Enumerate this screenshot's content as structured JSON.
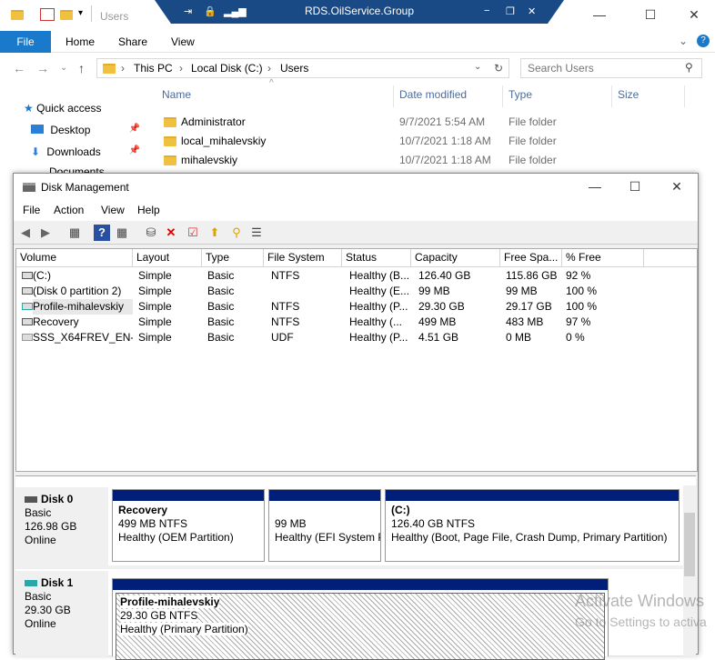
{
  "explorer": {
    "title_path": "Users",
    "remote_title": "RDS.OilService.Group",
    "ribbon_tabs": [
      "File",
      "Home",
      "Share",
      "View"
    ],
    "address": {
      "crumbs": [
        "This PC",
        "Local Disk (C:)",
        "Users"
      ]
    },
    "search_placeholder": "Search Users",
    "columns": [
      "Name",
      "Date modified",
      "Type",
      "Size"
    ],
    "files": [
      {
        "name": "Administrator",
        "date": "9/7/2021 5:54 AM",
        "type": "File folder"
      },
      {
        "name": "local_mihalevskiy",
        "date": "10/7/2021 1:18 AM",
        "type": "File folder"
      },
      {
        "name": "mihalevskiy",
        "date": "10/7/2021 1:18 AM",
        "type": "File folder"
      }
    ],
    "nav": [
      "Quick access",
      "Desktop",
      "Downloads",
      "Documents"
    ]
  },
  "dm": {
    "title": "Disk Management",
    "menu": [
      "File",
      "Action",
      "View",
      "Help"
    ],
    "columns": [
      "Volume",
      "Layout",
      "Type",
      "File System",
      "Status",
      "Capacity",
      "Free Spa...",
      "% Free"
    ],
    "volumes": [
      {
        "volume": "(C:)",
        "layout": "Simple",
        "type": "Basic",
        "fs": "NTFS",
        "status": "Healthy (B...",
        "capacity": "126.40 GB",
        "free": "115.86 GB",
        "pct": "92 %"
      },
      {
        "volume": "(Disk 0 partition 2)",
        "layout": "Simple",
        "type": "Basic",
        "fs": "",
        "status": "Healthy (E...",
        "capacity": "99 MB",
        "free": "99 MB",
        "pct": "100 %"
      },
      {
        "volume": "Profile-mihalevskiy",
        "layout": "Simple",
        "type": "Basic",
        "fs": "NTFS",
        "status": "Healthy (P...",
        "capacity": "29.30 GB",
        "free": "29.17 GB",
        "pct": "100 %"
      },
      {
        "volume": "Recovery",
        "layout": "Simple",
        "type": "Basic",
        "fs": "NTFS",
        "status": "Healthy (...",
        "capacity": "499 MB",
        "free": "483 MB",
        "pct": "97 %"
      },
      {
        "volume": "SSS_X64FREV_EN-...",
        "layout": "Simple",
        "type": "Basic",
        "fs": "UDF",
        "status": "Healthy (P...",
        "capacity": "4.51 GB",
        "free": "0 MB",
        "pct": "0 %"
      }
    ],
    "disk0": {
      "name": "Disk 0",
      "type": "Basic",
      "size": "126.98 GB",
      "state": "Online",
      "p1": {
        "name": "Recovery",
        "size": "499 MB NTFS",
        "status": "Healthy (OEM Partition)"
      },
      "p2": {
        "size": "99 MB",
        "status": "Healthy (EFI System P"
      },
      "p3": {
        "name": "(C:)",
        "size": "126.40 GB NTFS",
        "status": "Healthy (Boot, Page File, Crash Dump, Primary Partition)"
      }
    },
    "disk1": {
      "name": "Disk 1",
      "type": "Basic",
      "size": "29.30 GB",
      "state": "Online",
      "p1": {
        "name": "Profile-mihalevskiy",
        "size": "29.30 GB NTFS",
        "status": "Healthy (Primary Partition)"
      }
    }
  },
  "watermark": {
    "line1": "Activate Windows",
    "line2": "Go to Settings to activa"
  }
}
